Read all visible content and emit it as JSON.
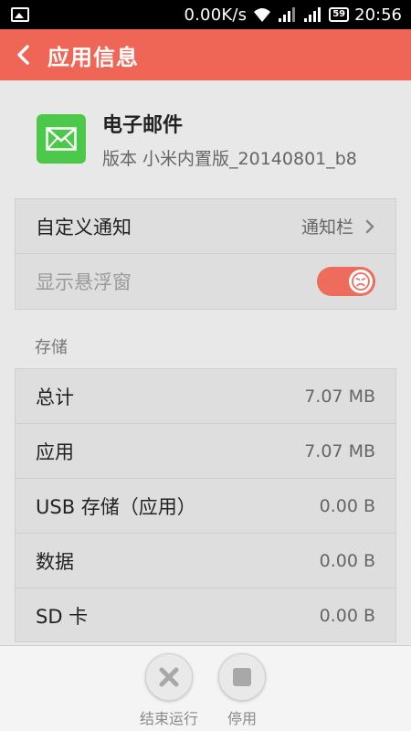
{
  "status_bar": {
    "speed": "0.00K/s",
    "battery": "59",
    "time": "20:56"
  },
  "header": {
    "title": "应用信息"
  },
  "app": {
    "name": "电子邮件",
    "version": "版本 小米内置版_20140801_b8"
  },
  "settings": {
    "custom_notification": {
      "label": "自定义通知",
      "value": "通知栏"
    },
    "floating_window": {
      "label": "显示悬浮窗",
      "enabled": true
    }
  },
  "storage": {
    "section_label": "存储",
    "rows": [
      {
        "label": "总计",
        "value": "7.07 MB"
      },
      {
        "label": "应用",
        "value": "7.07 MB"
      },
      {
        "label": "USB 存储（应用）",
        "value": "0.00 B"
      },
      {
        "label": "数据",
        "value": "0.00 B"
      },
      {
        "label": "SD 卡",
        "value": "0.00 B"
      }
    ]
  },
  "actions": {
    "force_stop": "结束运行",
    "disable": "停用"
  },
  "colors": {
    "accent": "#f06656",
    "app_icon": "#4cc94a"
  }
}
